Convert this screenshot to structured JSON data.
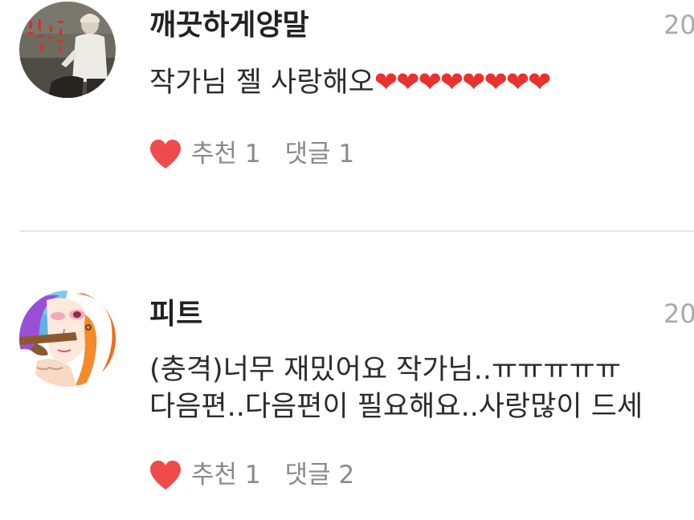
{
  "comments": [
    {
      "avatar_icon": "profile-photo-man-in-white",
      "username": "깨끗하게양말",
      "date": "20",
      "body_prefix": "작가님 젤 사랑해오",
      "body_hearts": "❤❤❤❤❤❤❤❤",
      "like_label": "추천 1",
      "reply_label": "댓글 1"
    },
    {
      "avatar_icon": "profile-drawing-orange-hair",
      "username": "피트",
      "date": "20",
      "body_lines": [
        "(충격)너무 재밌어요 작가님..ㅠㅠㅠㅠㅠ",
        "다음편..다음편이 필요해요..사랑많이 드세"
      ],
      "like_label": "추천 1",
      "reply_label": "댓글 2"
    }
  ],
  "colors": {
    "heart": "#f04b4b",
    "username": "#222222",
    "meta": "#8a8a8a",
    "divider": "#e6e6e6"
  }
}
